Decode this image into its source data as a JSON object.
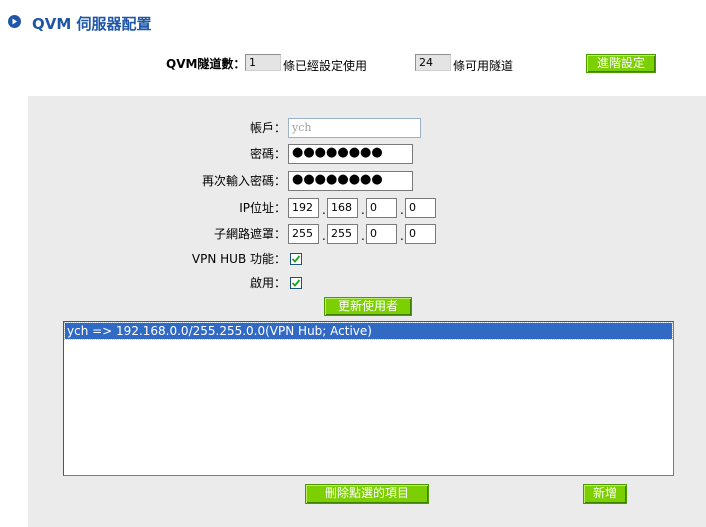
{
  "header": {
    "title": "QVM 伺服器配置",
    "icon": "circle-arrow-right-icon"
  },
  "tunnels": {
    "count_label": "QVM隧道數：",
    "used_value": "1",
    "used_suffix": "條已經設定使用",
    "available_value": "24",
    "available_suffix": "條可用隧道",
    "advanced_button": "進階設定"
  },
  "form": {
    "account": {
      "label": "帳戶：",
      "value": "ych"
    },
    "password": {
      "label": "密碼：",
      "value": "●●●●●●●●"
    },
    "confirm_password": {
      "label": "再次輸入密碼：",
      "value": "●●●●●●●●"
    },
    "ip": {
      "label": "IP位址：",
      "octets": [
        "192",
        "168",
        "0",
        "0"
      ]
    },
    "subnet": {
      "label": "子網路遮罩：",
      "octets": [
        "255",
        "255",
        "0",
        "0"
      ]
    },
    "vpn_hub": {
      "label": "VPN HUB 功能：",
      "checked": true
    },
    "enabled": {
      "label": "啟用：",
      "checked": true
    },
    "update_button": "更新使用者"
  },
  "list": {
    "items": [
      "ych => 192.168.0.0/255.255.0.0(VPN Hub; Active)"
    ]
  },
  "actions": {
    "delete_button": "刪除點選的項目",
    "add_button": "新增"
  },
  "colors": {
    "title": "#1f56a8",
    "button": "#7ccf00",
    "panel": "#ebebeb",
    "selection": "#316ac5"
  }
}
